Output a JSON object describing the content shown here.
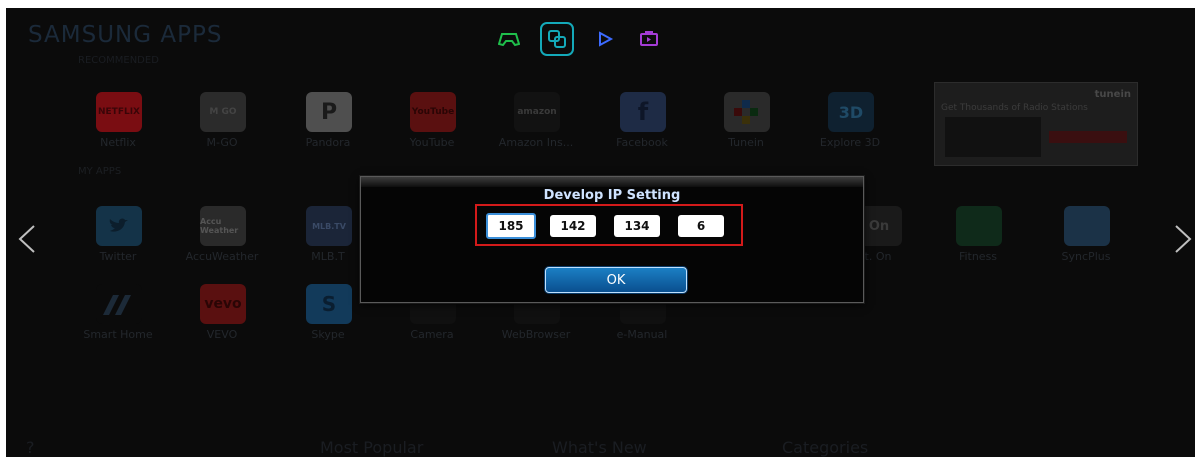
{
  "header": {
    "brand": "SAMSUNG APPS",
    "brand_sub": "RECOMMENDED",
    "top_icons": [
      "gamepad-icon",
      "apps-icon",
      "play-icon",
      "screen-icon"
    ]
  },
  "sections": {
    "recommended_label": "RECOMMENDED",
    "my_apps_label": "MY APPS"
  },
  "apps_row1": [
    {
      "label": "Netflix",
      "tile": "NETFLIX",
      "color": "#7a0d12"
    },
    {
      "label": "M-GO",
      "tile": "M GO",
      "color": "#2b2b2b"
    },
    {
      "label": "Pandora",
      "tile": "P",
      "color": "#5a5a5a"
    },
    {
      "label": "YouTube",
      "tile": "YouTube",
      "color": "#5a1010"
    },
    {
      "label": "Amazon Ins...",
      "tile": "amazon",
      "color": "#121212"
    },
    {
      "label": "Facebook",
      "tile": "f",
      "color": "#1e2b45"
    },
    {
      "label": "Tunein",
      "tile": "",
      "color": "#2a2a2a"
    },
    {
      "label": "Explore 3D",
      "tile": "3D",
      "color": "#0f2130"
    }
  ],
  "apps_row2": [
    {
      "label": "Twitter",
      "tile": "",
      "color": "#143348"
    },
    {
      "label": "AccuWeather",
      "tile": "Accu Weather",
      "color": "#2a2a2a"
    },
    {
      "label": "MLB.T",
      "tile": "MLB.TV",
      "color": "#1b2538"
    },
    {
      "label": "t. On",
      "tile": "On",
      "color": "#1a1a1a"
    },
    {
      "label": "Fitness",
      "tile": "",
      "color": "#0f2a1a"
    },
    {
      "label": "SyncPlus",
      "tile": "",
      "color": "#1b3247"
    }
  ],
  "apps_row3": [
    {
      "label": "Smart Home",
      "tile": "",
      "color": "#0b0b0b"
    },
    {
      "label": "VEVO",
      "tile": "vevo",
      "color": "#5a1010"
    },
    {
      "label": "Skype",
      "tile": "S",
      "color": "#123a5a"
    },
    {
      "label": "Camera",
      "tile": "",
      "color": "#101010"
    },
    {
      "label": "WebBrowser",
      "tile": "",
      "color": "#101010"
    },
    {
      "label": "e-Manual",
      "tile": "",
      "color": "#101010"
    }
  ],
  "tunein_banner": {
    "brand": "tunein",
    "text": "Get Thousands of Radio Stations"
  },
  "dialog": {
    "title": "Develop IP Setting",
    "ip": [
      "185",
      "142",
      "134",
      "6"
    ],
    "ok_label": "OK"
  },
  "bottom_bar": {
    "help": "?",
    "most_popular": "Most Popular",
    "whats_new": "What's New",
    "categories": "Categories"
  },
  "colors": {
    "accent": "#14a9b9",
    "dialog_title": "#cfe3ff",
    "highlight_border": "#d31a1a",
    "ok_button": "#1b7fc4"
  }
}
